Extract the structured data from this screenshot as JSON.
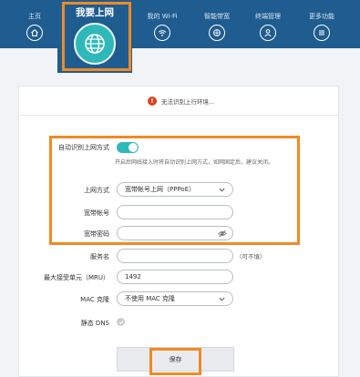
{
  "nav": {
    "home": "主页",
    "internet": "我要上网",
    "wifi": "我的 Wi-Fi",
    "bandwidth": "智能带宽",
    "devices": "终端管理",
    "more": "更多功能"
  },
  "status": {
    "message": "无法识别上行环境..."
  },
  "form": {
    "auto_detect_label": "自动识别上网方式",
    "auto_detect_enabled": true,
    "hint": "开启后网线接入时将自动识别上网方式，如网固定后，建议关闭。",
    "access_mode_label": "上网方式",
    "access_mode_value": "宽带帐号上网（PPPoE）",
    "account_label": "宽带帐号",
    "account_value": "",
    "password_label": "宽带密码",
    "password_value": "",
    "service_label": "服务名",
    "service_value": "",
    "service_note": "（可不填）",
    "mru_label": "最大接受单元（MRU）",
    "mru_value": "1492",
    "mac_label": "MAC 克隆",
    "mac_value": "不使用 MAC 克隆",
    "dns_label": "静态 DNS",
    "save_label": "保存"
  },
  "colors": {
    "topbar": "#1f5c8f",
    "accent": "#2fb8b9",
    "highlight": "#f08a24",
    "warning": "#e0401f"
  },
  "icons": [
    "home-icon",
    "globe-icon",
    "wifi-icon",
    "bandwidth-icon",
    "user-icon",
    "menu-icon",
    "warning-icon",
    "chevron-down-icon",
    "eye-icon",
    "check-icon"
  ]
}
